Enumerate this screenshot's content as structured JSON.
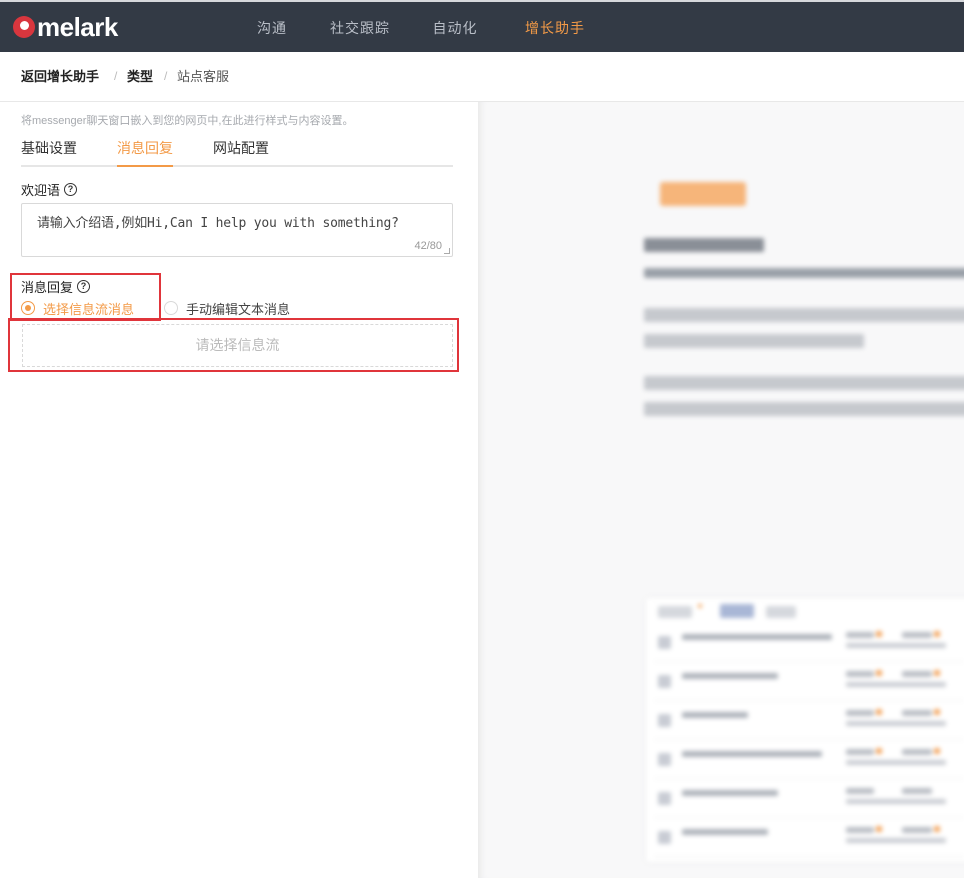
{
  "app": {
    "logo_text": "melark"
  },
  "nav": {
    "items": [
      "沟通",
      "社交跟踪",
      "自动化",
      "增长助手"
    ],
    "active_index": 3
  },
  "breadcrumb": {
    "items": [
      "返回增长助手",
      "类型",
      "站点客服"
    ],
    "separator": "/"
  },
  "panel": {
    "hint": "将messenger聊天窗口嵌入到您的网页中,在此进行样式与内容设置。",
    "tabs": [
      "基础设置",
      "消息回复",
      "网站配置"
    ],
    "active_tab_index": 1,
    "welcome": {
      "label": "欢迎语",
      "value": "请输入介绍语,例如Hi,Can I help you with something?",
      "count": "42/80"
    },
    "reply": {
      "label": "消息回复",
      "options": [
        "选择信息流消息",
        "手动编辑文本消息"
      ],
      "selected_index": 0,
      "flow_placeholder": "请选择信息流"
    }
  },
  "colors": {
    "accent": "#f39a47",
    "nav_bg": "#333a45",
    "highlight": "#e0353b"
  }
}
